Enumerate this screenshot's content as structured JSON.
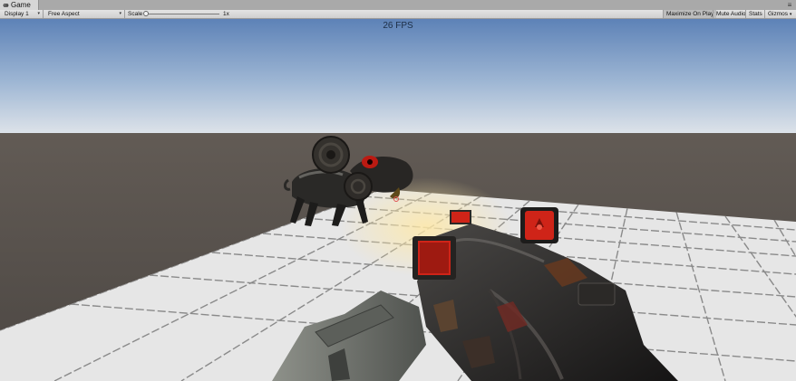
{
  "window": {
    "tab_label": "Game",
    "tab_icon": "game-view-icon",
    "menu_icon": "window-menu-icon"
  },
  "toolbar": {
    "display": "Display 1",
    "aspect": "Free Aspect",
    "scale_label": "Scale",
    "scale_value": "1x",
    "scale_level": 0,
    "maximize_on_play": "Maximize On Play",
    "mute_audio": "Mute Audio",
    "stats": "Stats",
    "gizmos": "Gizmos",
    "dropdown_icon": "dropdown-arrow-icon"
  },
  "viewport": {
    "fps": "26 FPS",
    "colors": {
      "sky_top": "#5d82b7",
      "sky_horizon": "#dfe4ea",
      "ground": "#5c5650",
      "floor_tile": "#e6e6e6",
      "accent_red": "#cf2418"
    }
  }
}
